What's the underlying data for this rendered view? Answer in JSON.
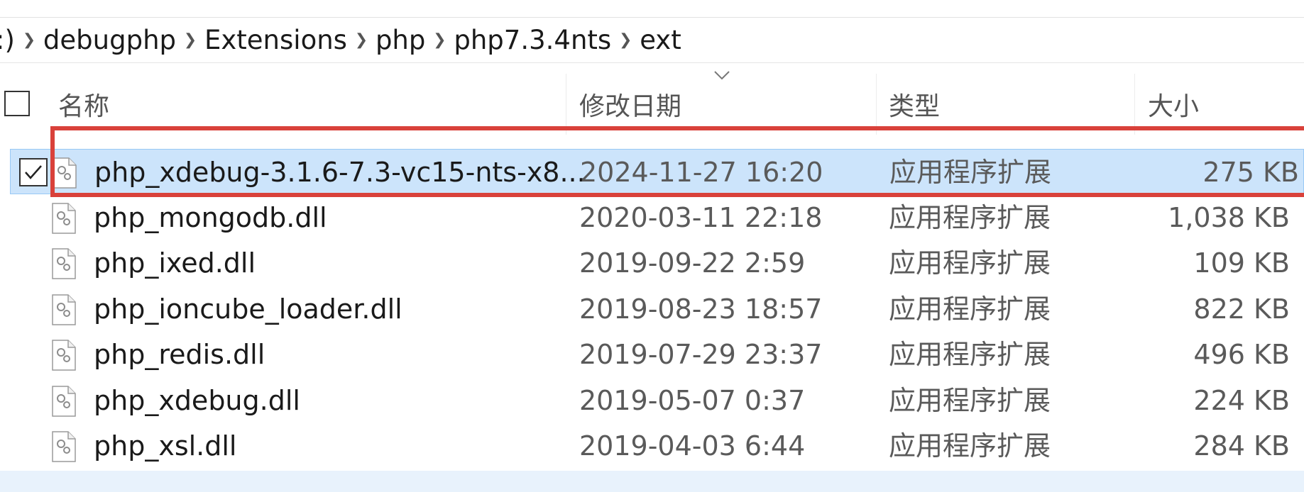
{
  "breadcrumb": {
    "prefix": ":)",
    "items": [
      "debugphp",
      "Extensions",
      "php",
      "php7.3.4nts",
      "ext"
    ]
  },
  "columns": {
    "name": "名称",
    "modified": "修改日期",
    "type": "类型",
    "size": "大小"
  },
  "files": [
    {
      "name": "php_xdebug-3.1.6-7.3-vc15-nts-x8...",
      "modified": "2024-11-27 16:20",
      "type": "应用程序扩展",
      "size": "275 KB",
      "selected": true
    },
    {
      "name": "php_mongodb.dll",
      "modified": "2020-03-11 22:18",
      "type": "应用程序扩展",
      "size": "1,038 KB"
    },
    {
      "name": "php_ixed.dll",
      "modified": "2019-09-22 2:59",
      "type": "应用程序扩展",
      "size": "109 KB"
    },
    {
      "name": "php_ioncube_loader.dll",
      "modified": "2019-08-23 18:57",
      "type": "应用程序扩展",
      "size": "822 KB"
    },
    {
      "name": "php_redis.dll",
      "modified": "2019-07-29 23:37",
      "type": "应用程序扩展",
      "size": "496 KB"
    },
    {
      "name": "php_xdebug.dll",
      "modified": "2019-05-07 0:37",
      "type": "应用程序扩展",
      "size": "224 KB"
    },
    {
      "name": "php_xsl.dll",
      "modified": "2019-04-03 6:44",
      "type": "应用程序扩展",
      "size": "284 KB"
    }
  ],
  "colors": {
    "selection": "#cce4fb",
    "highlight": "#d9413a"
  }
}
